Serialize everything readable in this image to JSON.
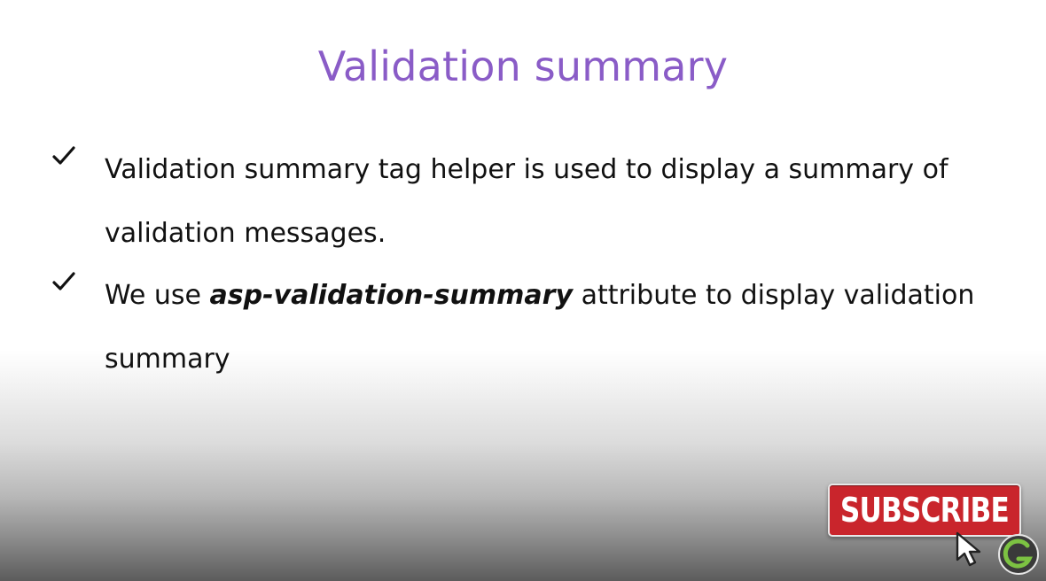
{
  "slide": {
    "title": "Validation summary",
    "title_color": "#8a5cc7",
    "bullets": [
      {
        "icon": "checkmark-icon",
        "parts": [
          {
            "text": "Validation summary tag helper is used to display a summary of validation messages.",
            "emphasis": false
          }
        ]
      },
      {
        "icon": "checkmark-icon",
        "parts": [
          {
            "text": "We use ",
            "emphasis": false
          },
          {
            "text": "asp-validation-summary",
            "emphasis": true
          },
          {
            "text": " attribute to display validation summary",
            "emphasis": false
          }
        ]
      }
    ]
  },
  "overlay": {
    "subscribe_label": "SUBSCRIBE",
    "subscribe_color": "#c9252c",
    "cursor_icon": "pointer-cursor-icon",
    "logo_icon": "channel-logo-icon",
    "logo_color": "#7cc242"
  }
}
